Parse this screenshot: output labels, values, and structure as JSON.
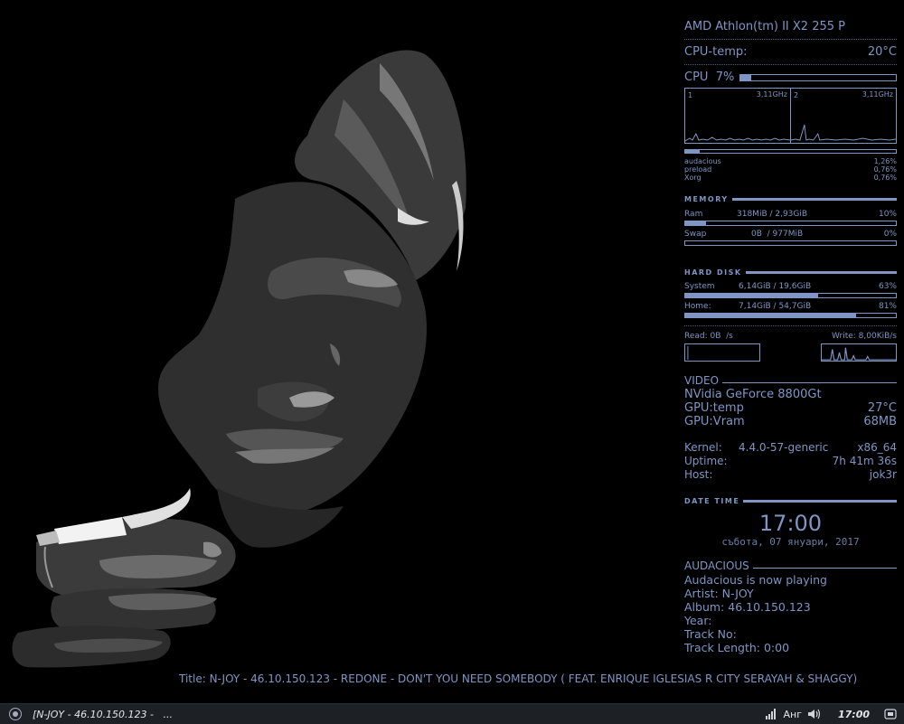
{
  "conky": {
    "cpu_model": "AMD Athlon(tm) II X2 255 P",
    "cpu_temp_label": "CPU-temp:",
    "cpu_temp_value": "20°C",
    "cpu_label": "CPU  7%",
    "cpu_usage_percent": 7,
    "core1_label": "1",
    "core1_freq": "3,11GHz",
    "core2_label": "2",
    "core2_freq": "3,11GHz",
    "top_processes": [
      {
        "name": "audacious",
        "value": "1,26%"
      },
      {
        "name": "preload",
        "value": "0,76%"
      },
      {
        "name": "Xorg",
        "value": "0,76%"
      }
    ],
    "memory": {
      "heading": "MEMORY",
      "ram_label": "Ram",
      "ram_value": "318MiB / 2,93GiB",
      "ram_percent_text": "10%",
      "ram_percent": 10,
      "swap_label": "Swap",
      "swap_value": "0B  / 977MiB",
      "swap_percent_text": "0%",
      "swap_percent": 0
    },
    "disk": {
      "heading": "HARD DISK",
      "system_label": "System",
      "system_value": "6,14GiB / 19,6GiB",
      "system_percent_text": "63%",
      "system_percent": 63,
      "home_label": "Home:",
      "home_value": "7,14GiB / 54,7GiB",
      "home_percent_text": "81%",
      "home_percent": 81,
      "read_label": "Read: 0B  /s",
      "write_label": "Write: 8,00KiB/s"
    },
    "video": {
      "heading": "VIDEO",
      "gpu_name": "NVidia GeForce 8800Gt",
      "gpu_temp_label": "GPU:temp",
      "gpu_temp_value": "27°C",
      "gpu_vram_label": "GPU:Vram",
      "gpu_vram_value": "68MB"
    },
    "system": {
      "kernel_label": "Kernel:",
      "kernel_value": "4.4.0-57-generic",
      "arch": "x86_64",
      "uptime_label": "Uptime:",
      "uptime_value": "7h 41m 36s",
      "host_label": "Host:",
      "host_value": "jok3r"
    },
    "datetime": {
      "heading": "DATE TIME",
      "clock": "17:00",
      "date": "събота, 07 януари, 2017"
    },
    "audacious": {
      "heading": "AUDACIOUS",
      "status": "Audacious is now playing",
      "artist": "Artist: N-JOY",
      "album": "Album: 46.10.150.123",
      "year": "Year:",
      "track_no": "Track No:",
      "track_length": "Track Length: 0:00",
      "title": "Title: N-JOY - 46.10.150.123 - REDONE - DON'T YOU NEED SOMEBODY ( FEAT. ENRIQUE IGLESIAS R CITY SERAYAH & SHAGGY)"
    }
  },
  "taskbar": {
    "task_label": "[N-JOY - 46.10.150.123 -   ...",
    "keyboard_layout": "Анг",
    "clock": "17:00",
    "icons": [
      "app-menu-icon",
      "network-signal-icon",
      "volume-icon",
      "show-desktop-icon"
    ]
  },
  "colors": {
    "accent": "#7f95c4",
    "background": "#000000",
    "taskbar": "#1d2025"
  }
}
